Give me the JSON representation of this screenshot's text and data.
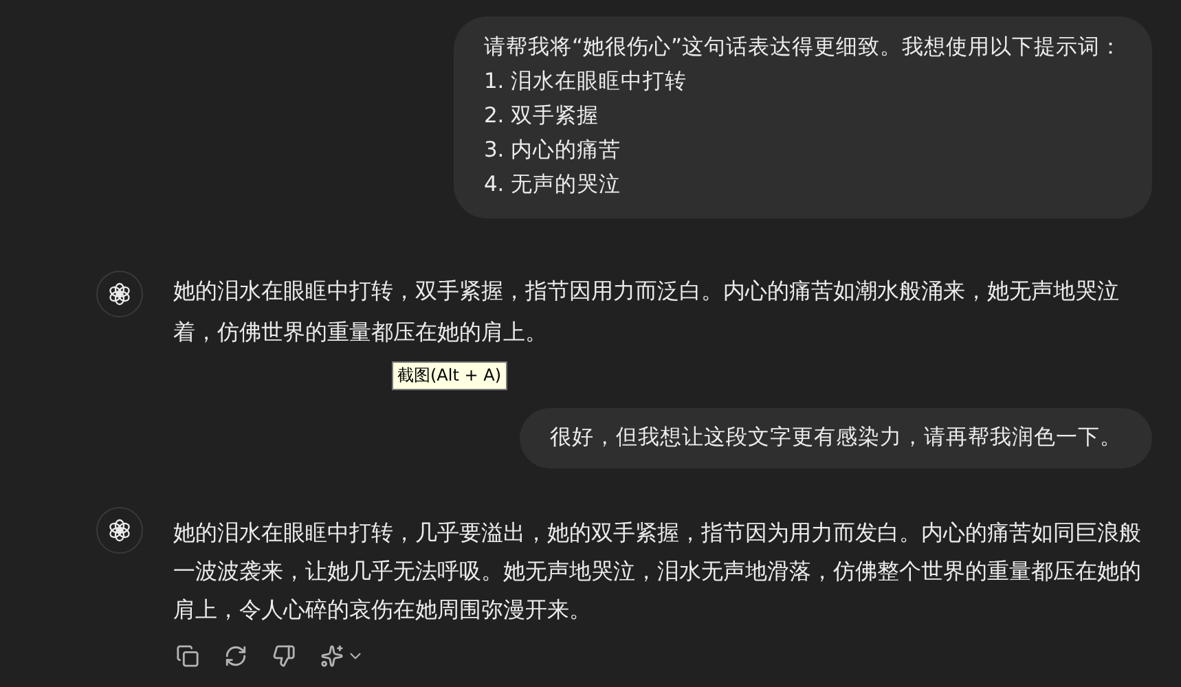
{
  "messages": [
    {
      "kind": "user",
      "lines": [
        "请帮我将“她很伤心”这句话表达得更细致。我想使用以下提示词：",
        "1. 泪水在眼眶中打转",
        "2. 双手紧握",
        "3. 内心的痛苦",
        "4. 无声的哭泣"
      ]
    },
    {
      "kind": "assistant",
      "text": "她的泪水在眼眶中打转，双手紧握，指节因用力而泛白。内心的痛苦如潮水般涌来，她无声地哭泣着，仿佛世界的重量都压在她的肩上。",
      "tooltip": "截图(Alt + A)"
    },
    {
      "kind": "user",
      "lines": [
        "很好，但我想让这段文字更有感染力，请再帮我润色一下。"
      ]
    },
    {
      "kind": "assistant",
      "text": "她的泪水在眼眶中打转，几乎要溢出，她的双手紧握，指节因为用力而发白。内心的痛苦如同巨浪般一波波袭来，让她几乎无法呼吸。她无声地哭泣，泪水无声地滑落，仿佛整个世界的重量都压在她的肩上，令人心碎的哀伤在她周围弥漫开来。",
      "actions": true
    }
  ]
}
